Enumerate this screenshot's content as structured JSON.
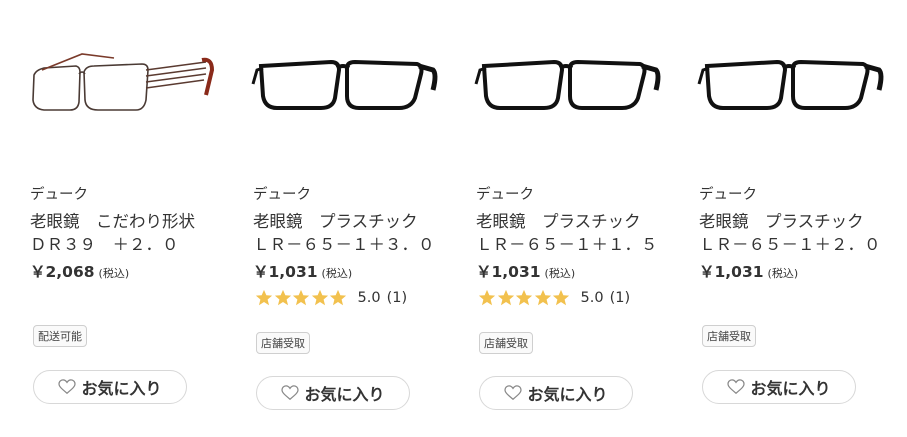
{
  "colors": {
    "star": "#f2c14e",
    "text": "#333333",
    "border": "#d8d8d8"
  },
  "products": [
    {
      "image": "wire-frame-glasses-brown",
      "brand": "デューク",
      "name_line1": "老眼鏡　こだわり形状",
      "name_line2": "ＤＲ３９　＋２．０",
      "price": "￥2,068",
      "tax": "(税込)",
      "rating": null,
      "badge": "配送可能",
      "favorite_label": "お気に入り"
    },
    {
      "image": "black-plastic-glasses",
      "brand": "デューク",
      "name_line1": "老眼鏡　プラスチック",
      "name_line2": "ＬＲ－６５－１＋３．０",
      "price": "￥1,031",
      "tax": "(税込)",
      "rating": {
        "stars": 5,
        "score": "5.0",
        "count": "(1)"
      },
      "badge": "店舗受取",
      "favorite_label": "お気に入り"
    },
    {
      "image": "black-plastic-glasses",
      "brand": "デューク",
      "name_line1": "老眼鏡　プラスチック",
      "name_line2": "ＬＲ－６５－１＋１．５",
      "price": "￥1,031",
      "tax": "(税込)",
      "rating": {
        "stars": 5,
        "score": "5.0",
        "count": "(1)"
      },
      "badge": "店舗受取",
      "favorite_label": "お気に入り"
    },
    {
      "image": "black-plastic-glasses",
      "brand": "デューク",
      "name_line1": "老眼鏡　プラスチック",
      "name_line2": "ＬＲ－６５－１＋２．０",
      "price": "￥1,031",
      "tax": "(税込)",
      "rating": null,
      "badge": "店舗受取",
      "favorite_label": "お気に入り"
    }
  ]
}
